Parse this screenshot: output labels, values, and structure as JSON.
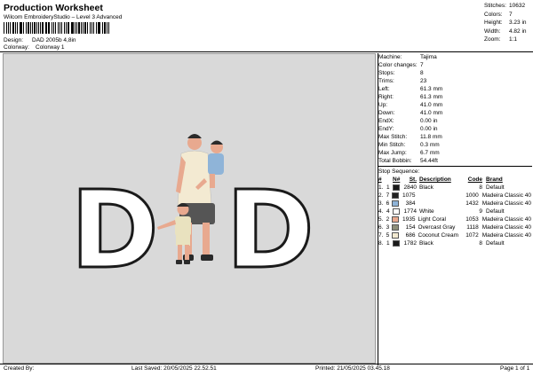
{
  "header": {
    "title": "Production Worksheet",
    "subtitle": "Wilcom EmbroideryStudio – Level 3 Advanced",
    "design_label": "Design:",
    "design_value": "DAD 2005b 4,8in",
    "colorway_label": "Colorway:",
    "colorway_value": "Colorway 1"
  },
  "stats": [
    {
      "k": "Stitches:",
      "v": "10632"
    },
    {
      "k": "Colors:",
      "v": "7"
    },
    {
      "k": "Height:",
      "v": "3.23 in"
    },
    {
      "k": "Width:",
      "v": "4.82 in"
    },
    {
      "k": "Zoom:",
      "v": "1:1"
    }
  ],
  "machine_info": [
    {
      "k": "Machine:",
      "v": "Tajima"
    },
    {
      "k": "Color changes:",
      "v": "7"
    },
    {
      "k": "Stops:",
      "v": "8"
    },
    {
      "k": "Trims:",
      "v": "23"
    },
    {
      "k": "Left:",
      "v": "61.3 mm"
    },
    {
      "k": "Right:",
      "v": "61.3 mm"
    },
    {
      "k": "Up:",
      "v": "41.0 mm"
    },
    {
      "k": "Down:",
      "v": "41.0 mm"
    },
    {
      "k": "EndX:",
      "v": "0.00 in"
    },
    {
      "k": "EndY:",
      "v": "0.00 in"
    },
    {
      "k": "Max Stitch:",
      "v": "11.8 mm"
    },
    {
      "k": "Min Stitch:",
      "v": "0.3 mm"
    },
    {
      "k": "Max Jump:",
      "v": "6.7 mm"
    },
    {
      "k": "Total Bobbin:",
      "v": "54.44ft"
    }
  ],
  "stop_sequence": {
    "title": "Stop Sequence:",
    "headers": {
      "idx": "#",
      "n": "N#",
      "st": "St.",
      "desc": "Description",
      "code": "Code",
      "brand": "Brand"
    },
    "rows": [
      {
        "idx": "1.",
        "n": "1",
        "color": "#1a1a1a",
        "st": "2840",
        "desc": "Black",
        "code": "8",
        "brand": "Default"
      },
      {
        "idx": "2.",
        "n": "7",
        "color": "#222222",
        "st": "1075",
        "desc": "",
        "code": "1000",
        "brand": "Madeira Classic 40"
      },
      {
        "idx": "3.",
        "n": "6",
        "color": "#8fb4d8",
        "st": "384",
        "desc": "",
        "code": "1432",
        "brand": "Madeira Classic 40"
      },
      {
        "idx": "4.",
        "n": "4",
        "color": "#ffffff",
        "st": "1774",
        "desc": "White",
        "code": "9",
        "brand": "Default"
      },
      {
        "idx": "5.",
        "n": "2",
        "color": "#e8a98f",
        "st": "1935",
        "desc": "Light Coral",
        "code": "1053",
        "brand": "Madeira Classic 40"
      },
      {
        "idx": "6.",
        "n": "3",
        "color": "#8e8f7a",
        "st": "154",
        "desc": "Overcast Gray",
        "code": "1118",
        "brand": "Madeira Classic 40"
      },
      {
        "idx": "7.",
        "n": "5",
        "color": "#f3ead2",
        "st": "686",
        "desc": "Coconut Cream",
        "code": "1072",
        "brand": "Madeira Classic 40"
      },
      {
        "idx": "8.",
        "n": "1",
        "color": "#1a1a1a",
        "st": "1782",
        "desc": "Black",
        "code": "8",
        "brand": "Default"
      }
    ]
  },
  "design_letters": {
    "left": "D",
    "right": "D"
  },
  "footer": {
    "created_by": "Created By:",
    "last_saved": "Last Saved: 20/05/2025 22.52.51",
    "printed": "Printed: 21/05/2025 03.45.18",
    "page": "Page 1 of 1"
  }
}
